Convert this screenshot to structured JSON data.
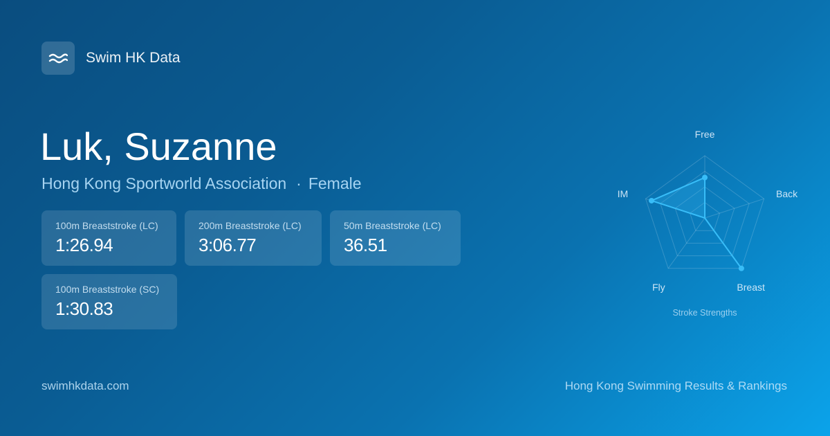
{
  "brand": {
    "logo_icon": "wave-icon",
    "name": "Swim HK Data"
  },
  "swimmer": {
    "name": "Luk, Suzanne",
    "club": "Hong Kong Sportworld Association",
    "separator": "·",
    "gender": "Female"
  },
  "best_times": [
    {
      "event": "100m Breaststroke (LC)",
      "time": "1:26.94"
    },
    {
      "event": "200m Breaststroke (LC)",
      "time": "3:06.77"
    },
    {
      "event": "50m Breaststroke (LC)",
      "time": "36.51"
    },
    {
      "event": "100m Breaststroke (SC)",
      "time": "1:30.83"
    }
  ],
  "chart_data": {
    "type": "radar",
    "title": "Stroke Strengths",
    "axes": [
      "Free",
      "Back",
      "Breast",
      "Fly",
      "IM"
    ],
    "values": [
      0.65,
      0.0,
      1.0,
      0.0,
      0.9
    ],
    "range": [
      0,
      1
    ],
    "grid_levels": 4,
    "colors": {
      "line": "#38bdf8",
      "fill": "rgba(56,189,248,0.25)",
      "grid": "rgba(255,255,255,0.18)"
    }
  },
  "footer": {
    "domain": "swimhkdata.com",
    "tagline": "Hong Kong Swimming Results & Rankings"
  }
}
